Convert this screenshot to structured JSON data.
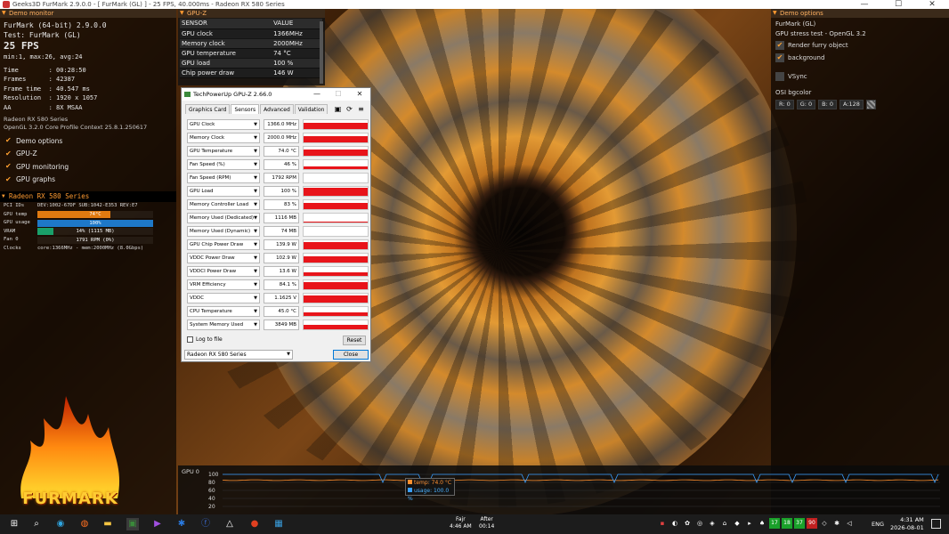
{
  "window": {
    "title": "Geeks3D FurMark 2.9.0.0 - [ FurMark (GL) ] - 25 FPS, 40.000ms - Radeon RX 580 Series",
    "min": "—",
    "max": "☐",
    "close": "✕"
  },
  "demo_monitor": {
    "header": "Demo monitor",
    "app": "FurMark (64-bit) 2.9.0.0",
    "test": "Test: FurMark (GL)",
    "fps": "25 FPS",
    "fps_stats": "min:1, max:26, avg:24",
    "time": "Time        : 00:28:50",
    "frames": "Frames      : 42387",
    "frame_time": "Frame time  : 40.547 ms",
    "resolution": "Resolution  : 1920 x 1057",
    "aa": "AA          : 8X MSAA",
    "gpu_name": "Radeon RX 580 Series",
    "opengl": "OpenGL 3.2.0 Core Profile Context 25.8.1.250617",
    "checks": [
      {
        "label": "Demo options"
      },
      {
        "label": "GPU-Z"
      },
      {
        "label": "GPU monitoring"
      },
      {
        "label": "GPU graphs"
      }
    ],
    "gpu_header": "Radeon RX 580 Series",
    "pci": "PCI IDs",
    "pci_val": "DEV:1002-67DF SUB:1042-E353 REV:E7",
    "rows": [
      {
        "key": "GPU temp",
        "text": "74°C",
        "level": 0.63,
        "color": "#e07a10"
      },
      {
        "key": "GPU usage",
        "text": "100%",
        "level": 1.0,
        "color": "#1e78c8"
      },
      {
        "key": "VRAM",
        "text": "14% (1115 MB)",
        "level": 0.14,
        "color": "#1aa06a"
      },
      {
        "key": "Fan 0",
        "text": "1791 RPM (0%)",
        "level": 0.0,
        "color": "#888888"
      }
    ],
    "clocks_key": "Clocks",
    "clocks_val": "core:1366MHz - mem:2000MHz (8.0Gbps)",
    "logo": "FURMARK"
  },
  "gpuz_overlay": {
    "header": "GPU-Z",
    "col_sensor": "SENSOR",
    "col_value": "VALUE",
    "rows": [
      {
        "sensor": "GPU clock",
        "value": "1366MHz"
      },
      {
        "sensor": "Memory clock",
        "value": "2000MHz"
      },
      {
        "sensor": "GPU temperature",
        "value": "74 °C"
      },
      {
        "sensor": "GPU load",
        "value": "100 %"
      },
      {
        "sensor": "Chip power draw",
        "value": "146 W"
      }
    ]
  },
  "gpuz_window": {
    "title": "TechPowerUp GPU-Z 2.66.0",
    "tabs": [
      "Graphics Card",
      "Sensors",
      "Advanced",
      "Validation"
    ],
    "active_tab": 1,
    "tool_icons": [
      "camera-icon",
      "refresh-icon",
      "menu-icon"
    ],
    "sensors": [
      {
        "label": "GPU Clock",
        "value": "1366.0 MHz",
        "level": 0.72
      },
      {
        "label": "Memory Clock",
        "value": "2000.0 MHz",
        "level": 0.72
      },
      {
        "label": "GPU Temperature",
        "value": "74.0 °C",
        "level": 0.68
      },
      {
        "label": "Fan Speed (%)",
        "value": "46 %",
        "level": 0.35
      },
      {
        "label": "Fan Speed (RPM)",
        "value": "1792 RPM",
        "level": 0.0
      },
      {
        "label": "GPU Load",
        "value": "100 %",
        "level": 0.95
      },
      {
        "label": "Memory Controller Load",
        "value": "83 %",
        "level": 0.75
      },
      {
        "label": "Memory Used (Dedicated)",
        "value": "1116 MB",
        "level": 0.12
      },
      {
        "label": "Memory Used (Dynamic)",
        "value": "74 MB",
        "level": 0.05
      },
      {
        "label": "GPU Chip Power Draw",
        "value": "139.9 W",
        "level": 0.8
      },
      {
        "label": "VDDC Power Draw",
        "value": "102.9 W",
        "level": 0.72
      },
      {
        "label": "VDDCI Power Draw",
        "value": "13.6 W",
        "level": 0.4
      },
      {
        "label": "VRM Efficiency",
        "value": "84.1 %",
        "level": 0.8
      },
      {
        "label": "VDDC",
        "value": "1.1625 V",
        "level": 0.8
      },
      {
        "label": "CPU Temperature",
        "value": "45.0 °C",
        "level": 0.45
      },
      {
        "label": "System Memory Used",
        "value": "3849 MB",
        "level": 0.5
      }
    ],
    "log_label": "Log to file",
    "reset": "Reset",
    "device": "Radeon RX 580 Series",
    "close_btn": "Close"
  },
  "demo_options": {
    "header": "Demo options",
    "name": "FurMark (GL)",
    "desc": "GPU stress test - OpenGL 3.2",
    "render_furry": "Render furry object",
    "background": "background",
    "vsync": "VSync",
    "osi_label": "OSI bgcolor",
    "r": "R: 0",
    "g": "G: 0",
    "b": "B: 0",
    "a": "A:128"
  },
  "graph": {
    "label": "GPU 0",
    "yticks": [
      "100",
      "80",
      "60",
      "40",
      "20"
    ],
    "legend_temp": "temp: 74.0 °C",
    "legend_usage": "usage: 100.0 %",
    "temp_color": "#ff9030",
    "usage_color": "#3a9fff"
  },
  "taskbar": {
    "weather1": "Fajr",
    "weather2": "4:46 AM",
    "after1": "After",
    "after2": "00:14",
    "tray_nums": [
      "17",
      "18",
      "37",
      "90"
    ],
    "lang": "ENG",
    "time": "4:31 AM",
    "date": "2026-08-01",
    "apps": [
      "windows-icon",
      "search-icon",
      "edge-icon",
      "firefox-icon",
      "explorer-icon",
      "furmark-icon",
      "media-icon",
      "bluetooth-icon",
      "facebook-icon",
      "app-icon",
      "furmark-taskbar-icon",
      "gpuz-taskbar-icon"
    ]
  }
}
